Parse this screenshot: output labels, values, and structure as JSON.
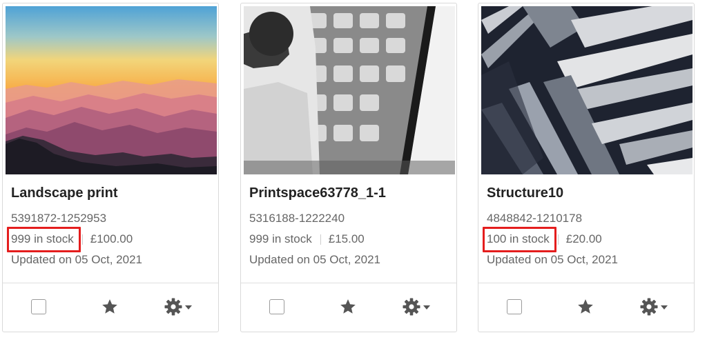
{
  "products": [
    {
      "title": "Landscape print",
      "sku": "5391872-1252953",
      "stock": "999 in stock",
      "price": "£100.00",
      "updated": "Updated on 05 Oct, 2021",
      "stock_highlighted": true,
      "image": "mountain-sunset-image"
    },
    {
      "title": "Printspace63778_1-1",
      "sku": "5316188-1222240",
      "stock": "999 in stock",
      "price": "£15.00",
      "updated": "Updated on 05 Oct, 2021",
      "stock_highlighted": false,
      "image": "black-and-white-print-image"
    },
    {
      "title": "Structure10",
      "sku": "4848842-1210178",
      "stock": "100 in stock",
      "price": "£20.00",
      "updated": "Updated on 05 Oct, 2021",
      "stock_highlighted": true,
      "image": "architecture-structure-image"
    }
  ],
  "colors": {
    "highlight": "#e41d1d",
    "icon": "#555555",
    "text_muted": "#666666"
  },
  "icons": {
    "select": "checkbox",
    "favorite": "star-icon",
    "settings": "gear-icon"
  }
}
